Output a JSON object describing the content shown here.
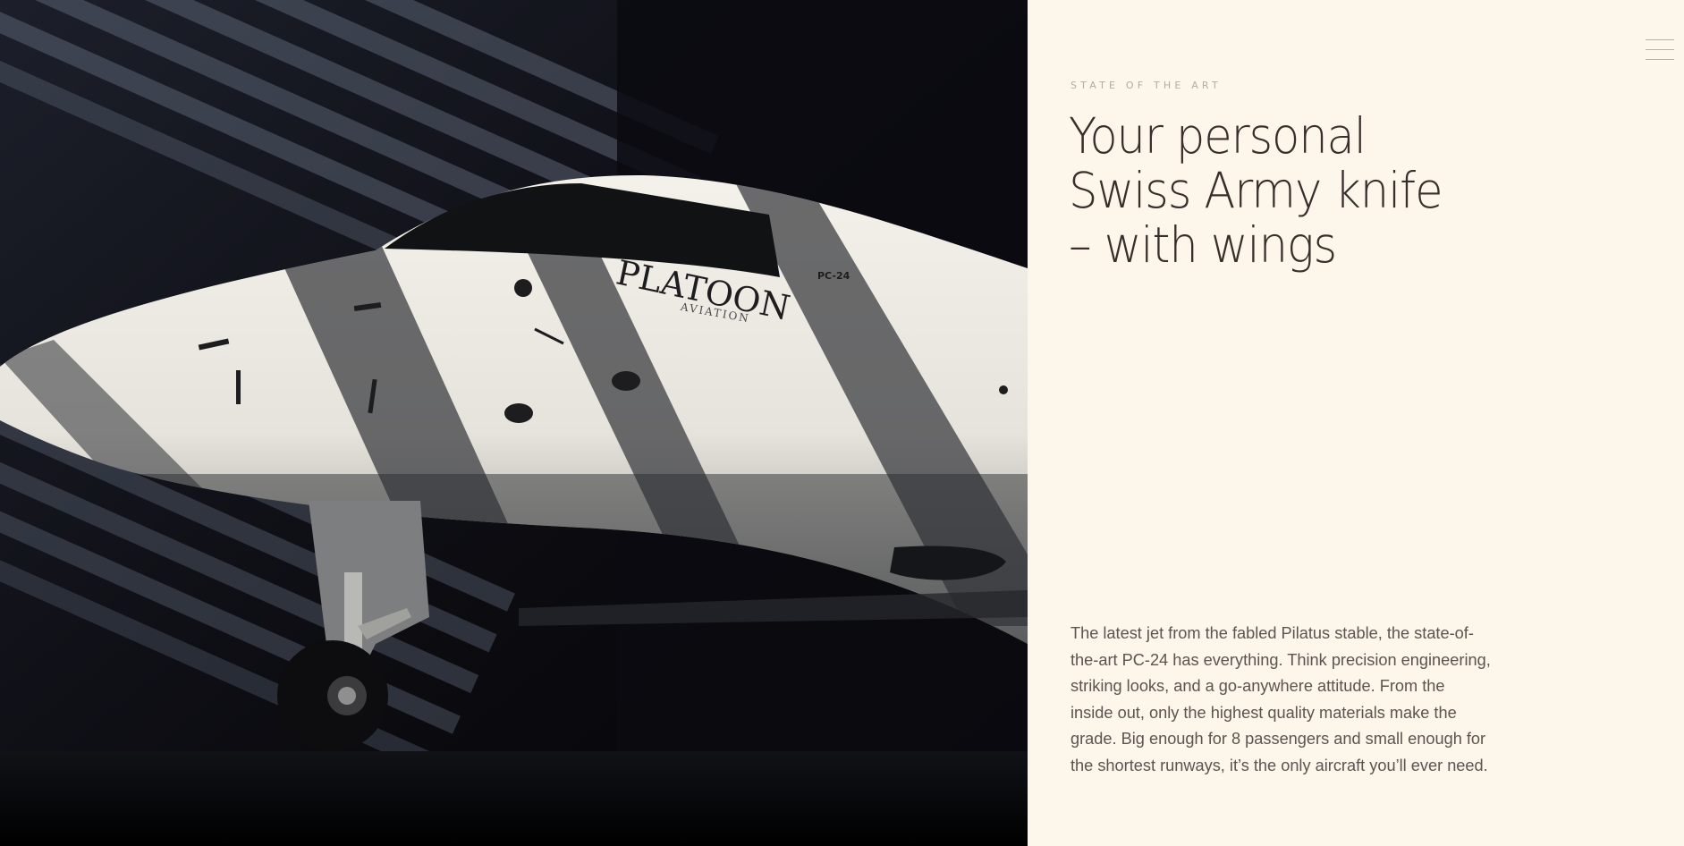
{
  "hero": {
    "aircraft_logo": "PLATOON",
    "aircraft_logo_sub": "AVIATION",
    "aircraft_model_badge": "PC-24"
  },
  "header": {
    "menu_icon": "hamburger-menu-icon"
  },
  "section": {
    "eyebrow": "STATE OF THE ART",
    "headline_lines": [
      "Your personal",
      "Swiss Army knife",
      "– with wings"
    ],
    "body": "The latest jet from the fabled Pilatus stable, the state-of-the-art PC-24 has everything. Think precision engineering, striking looks, and a go-anywhere attitude. From the inside out, only the highest quality materials make the grade. Big enough for 8 passengers and small enough for the shortest runways, it’s the only aircraft you’ll ever need."
  },
  "colors": {
    "panel_background": "#fdf6ea",
    "headline": "#3a2e2c",
    "body_text": "#5d5350",
    "eyebrow": "#b3aca2",
    "image_background": "#0c0c12"
  }
}
